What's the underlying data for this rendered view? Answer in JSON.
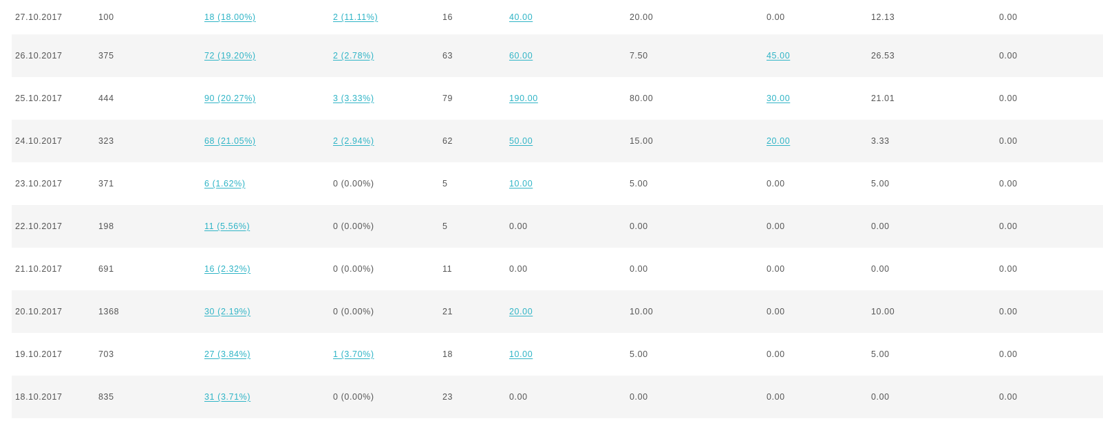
{
  "colors": {
    "link": "#2fb4c6",
    "text": "#555555",
    "row_alt_background": "#f5f5f5"
  },
  "rows": [
    {
      "date": "27.10.2017",
      "col2": "100",
      "col3": "18 (18.00%)",
      "col4": "2 (11.11%)",
      "col5": "16",
      "col6": "40.00",
      "col7": "20.00",
      "col8": "0.00",
      "col9": "12.13",
      "col10": "0.00",
      "links": {
        "col3": true,
        "col4": true,
        "col6": true,
        "col8": false
      }
    },
    {
      "date": "26.10.2017",
      "col2": "375",
      "col3": "72 (19.20%)",
      "col4": "2 (2.78%)",
      "col5": "63",
      "col6": "60.00",
      "col7": "7.50",
      "col8": "45.00",
      "col9": "26.53",
      "col10": "0.00",
      "links": {
        "col3": true,
        "col4": true,
        "col6": true,
        "col8": true
      }
    },
    {
      "date": "25.10.2017",
      "col2": "444",
      "col3": "90 (20.27%)",
      "col4": "3 (3.33%)",
      "col5": "79",
      "col6": "190.00",
      "col7": "80.00",
      "col8": "30.00",
      "col9": "21.01",
      "col10": "0.00",
      "links": {
        "col3": true,
        "col4": true,
        "col6": true,
        "col8": true
      }
    },
    {
      "date": "24.10.2017",
      "col2": "323",
      "col3": "68 (21.05%)",
      "col4": "2 (2.94%)",
      "col5": "62",
      "col6": "50.00",
      "col7": "15.00",
      "col8": "20.00",
      "col9": "3.33",
      "col10": "0.00",
      "links": {
        "col3": true,
        "col4": true,
        "col6": true,
        "col8": true
      }
    },
    {
      "date": "23.10.2017",
      "col2": "371",
      "col3": "6 (1.62%)",
      "col4": "0 (0.00%)",
      "col5": "5",
      "col6": "10.00",
      "col7": "5.00",
      "col8": "0.00",
      "col9": "5.00",
      "col10": "0.00",
      "links": {
        "col3": true,
        "col4": false,
        "col6": true,
        "col8": false
      }
    },
    {
      "date": "22.10.2017",
      "col2": "198",
      "col3": "11 (5.56%)",
      "col4": "0 (0.00%)",
      "col5": "5",
      "col6": "0.00",
      "col7": "0.00",
      "col8": "0.00",
      "col9": "0.00",
      "col10": "0.00",
      "links": {
        "col3": true,
        "col4": false,
        "col6": false,
        "col8": false
      }
    },
    {
      "date": "21.10.2017",
      "col2": "691",
      "col3": "16 (2.32%)",
      "col4": "0 (0.00%)",
      "col5": "11",
      "col6": "0.00",
      "col7": "0.00",
      "col8": "0.00",
      "col9": "0.00",
      "col10": "0.00",
      "links": {
        "col3": true,
        "col4": false,
        "col6": false,
        "col8": false
      }
    },
    {
      "date": "20.10.2017",
      "col2": "1368",
      "col3": "30 (2.19%)",
      "col4": "0 (0.00%)",
      "col5": "21",
      "col6": "20.00",
      "col7": "10.00",
      "col8": "0.00",
      "col9": "10.00",
      "col10": "0.00",
      "links": {
        "col3": true,
        "col4": false,
        "col6": true,
        "col8": false
      }
    },
    {
      "date": "19.10.2017",
      "col2": "703",
      "col3": "27 (3.84%)",
      "col4": "1 (3.70%)",
      "col5": "18",
      "col6": "10.00",
      "col7": "5.00",
      "col8": "0.00",
      "col9": "5.00",
      "col10": "0.00",
      "links": {
        "col3": true,
        "col4": true,
        "col6": true,
        "col8": false
      }
    },
    {
      "date": "18.10.2017",
      "col2": "835",
      "col3": "31 (3.71%)",
      "col4": "0 (0.00%)",
      "col5": "23",
      "col6": "0.00",
      "col7": "0.00",
      "col8": "0.00",
      "col9": "0.00",
      "col10": "0.00",
      "links": {
        "col3": true,
        "col4": false,
        "col6": false,
        "col8": false
      }
    }
  ]
}
